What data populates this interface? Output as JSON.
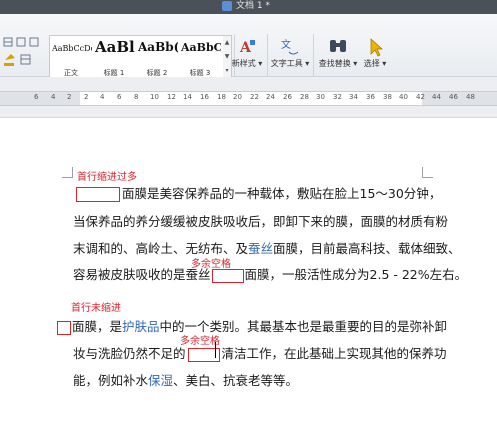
{
  "window": {
    "title": "文档 1 *"
  },
  "ribbon": {
    "styles": [
      {
        "sample": "AaBbCcDd",
        "label": "正文"
      },
      {
        "sample": "AaBl",
        "label": "标题 1"
      },
      {
        "sample": "AaBb(",
        "label": "标题 2"
      },
      {
        "sample": "AaBbC",
        "label": "标题 3"
      }
    ],
    "buttons": {
      "new_style": "新样式",
      "text_tools": "文字工具",
      "find_replace": "查找替换",
      "select": "选择"
    }
  },
  "ruler": {
    "ticks": [
      "6",
      "4",
      "2",
      "2",
      "4",
      "6",
      "8",
      "10",
      "12",
      "14",
      "16",
      "18",
      "20",
      "22",
      "24",
      "26",
      "28",
      "30",
      "32",
      "34",
      "36",
      "38",
      "40",
      "42",
      "44",
      "46",
      "48"
    ]
  },
  "document": {
    "annotations": {
      "indent_too_much": "首行缩进过多",
      "extra_space_1": "多余空格",
      "indent_none": "首行未缩进",
      "extra_space_2": "多余空格"
    },
    "para1": {
      "line1": "面膜是美容保养品的一种载体，敷贴在脸上15～30分钟，",
      "line2": "当保养品的养分缓缓被皮肤吸收后，即卸下来的膜，面膜的材质有粉",
      "line3_a": "末调和的、高岭土、无纺布、及",
      "line3_hl": "蚕丝",
      "line3_b": "面膜，目前最高科技、载体细致、",
      "line4_a": "容易被皮肤吸收的是蚕丝",
      "line4_b": "面膜，一般活性成分为2.5 - 22%左右。"
    },
    "para2": {
      "line1_a": "面膜，是",
      "line1_hl": "护肤品",
      "line1_b": "中的一个类别。其最基本也是最重要的目的是弥补卸",
      "line2_a": "妆与洗脸仍然不足的",
      "line2_b": "清洁工作，在此基础上实现其他的保养功",
      "line3_a": "能，例如补水",
      "line3_hl": "保湿",
      "line3_b": "、美白、抗衰老等等。"
    }
  }
}
